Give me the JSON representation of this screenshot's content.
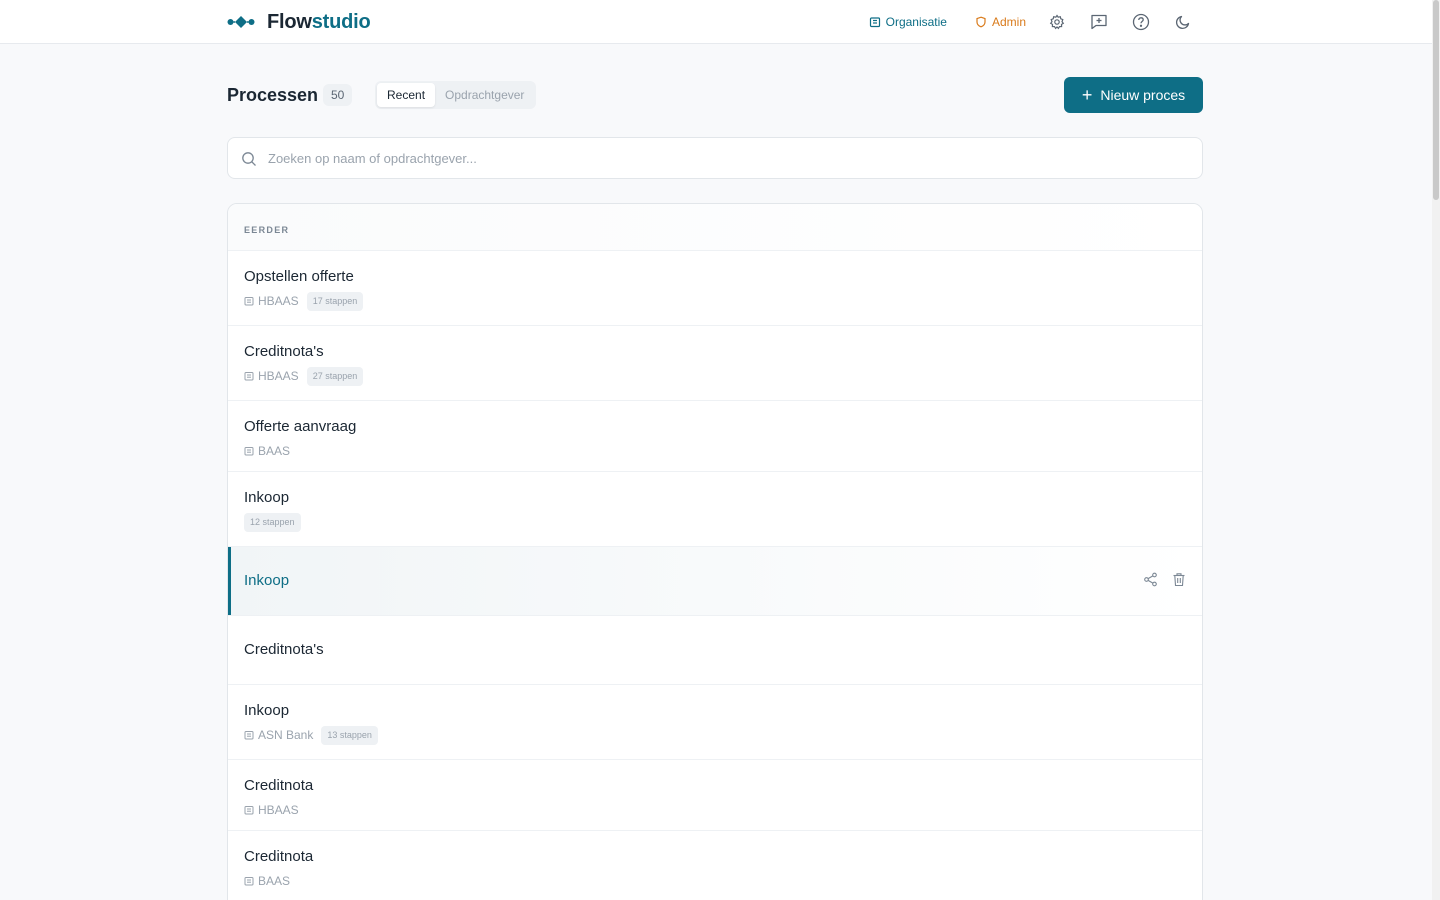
{
  "header": {
    "brand_part1": "Flow",
    "brand_part2": "studio",
    "nav": {
      "organisatie": "Organisatie",
      "admin": "Admin"
    },
    "icons": [
      "settings-icon",
      "feedback-icon",
      "help-icon",
      "dark-mode-icon"
    ]
  },
  "page": {
    "title": "Processen",
    "count": "50",
    "tabs": [
      {
        "label": "Recent",
        "active": true
      },
      {
        "label": "Opdrachtgever",
        "active": false
      }
    ],
    "new_button": "Nieuw proces",
    "search_placeholder": "Zoeken op naam of opdrachtgever..."
  },
  "list": {
    "section_label": "EERDER",
    "rows": [
      {
        "title": "Opstellen offerte",
        "org": "HBAAS",
        "steps": "17 stappen"
      },
      {
        "title": "Creditnota's",
        "org": "HBAAS",
        "steps": "27 stappen"
      },
      {
        "title": "Offerte aanvraag",
        "org": "BAAS"
      },
      {
        "title": "Inkoop",
        "steps": "12 stappen"
      },
      {
        "title": "Inkoop",
        "selected": true
      },
      {
        "title": "Creditnota's"
      },
      {
        "title": "Inkoop",
        "org": "ASN Bank",
        "steps": "13 stappen"
      },
      {
        "title": "Creditnota",
        "org": "HBAAS"
      },
      {
        "title": "Creditnota",
        "org": "BAAS"
      }
    ]
  },
  "colors": {
    "accent": "#0e6e86",
    "admin": "#d97a1a",
    "background": "#f8f9fb"
  }
}
